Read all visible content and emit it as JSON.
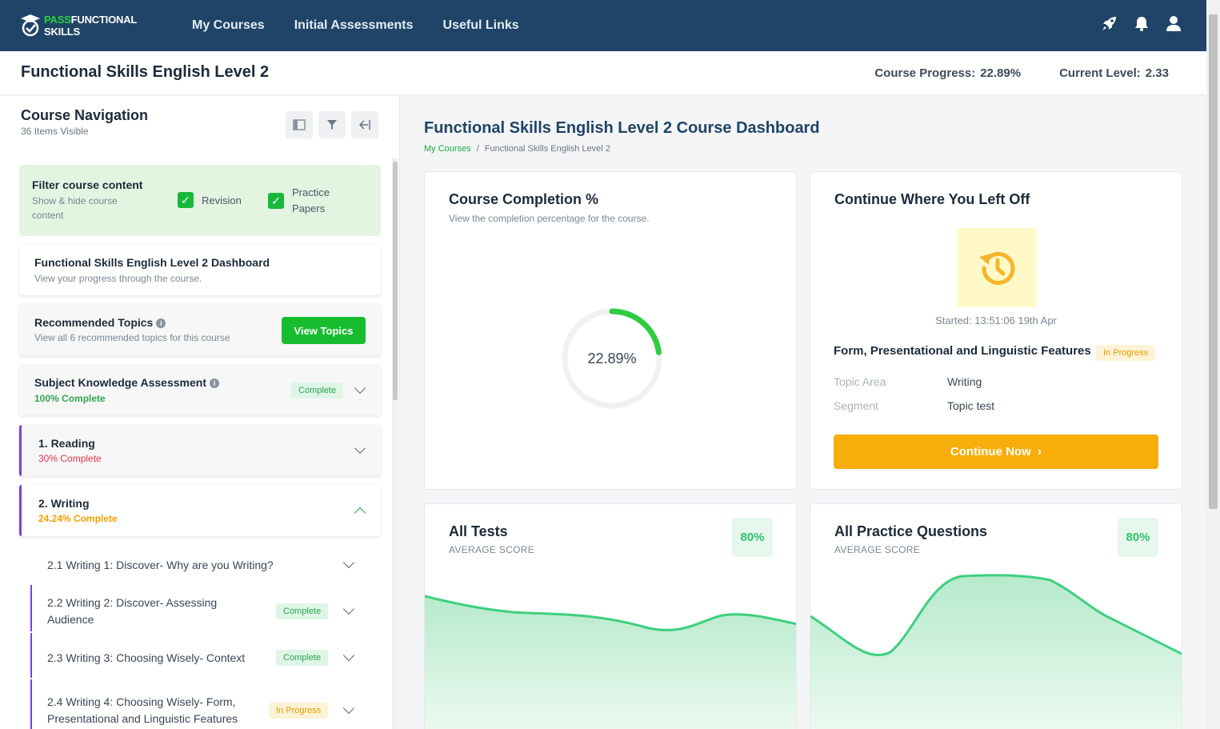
{
  "app": {
    "logo_pass": "PASS",
    "logo_rest": "FUNCTIONAL SKILLS",
    "nav": [
      "My Courses",
      "Initial Assessments",
      "Useful Links"
    ],
    "icons": [
      "rocket-icon",
      "bell-icon",
      "user-icon"
    ]
  },
  "course": {
    "title": "Functional Skills English Level 2",
    "progress_label": "Course Progress:",
    "progress_value": "22.89%",
    "level_label": "Current Level:",
    "level_value": "2.33"
  },
  "sidebar": {
    "title": "Course Navigation",
    "subtitle": "36 Items Visible",
    "filter": {
      "title": "Filter course content",
      "subtitle": "Show & hide course content",
      "options": [
        "Revision",
        "Practice Papers"
      ]
    },
    "dashboard": {
      "title": "Functional Skills English Level 2 Dashboard",
      "subtitle": "View your progress through the course."
    },
    "recommended": {
      "title": "Recommended Topics",
      "subtitle": "View all 6 recommended topics for this course",
      "button": "View Topics"
    },
    "ska": {
      "title": "Subject Knowledge Assessment",
      "percent": "100% Complete",
      "badge": "Complete"
    },
    "sections": [
      {
        "title": "1. Reading",
        "percent": "30% Complete"
      },
      {
        "title": "2. Writing",
        "percent": "24.24% Complete"
      }
    ],
    "subitems": [
      {
        "title": "2.1 Writing 1: Discover- Why are you Writing?",
        "badge": ""
      },
      {
        "title": "2.2 Writing 2: Discover- Assessing Audience",
        "badge": "Complete"
      },
      {
        "title": "2.3 Writing 3: Choosing Wisely- Context",
        "badge": "Complete"
      },
      {
        "title": "2.4 Writing 4: Choosing Wisely- Form, Presentational and Linguistic Features",
        "badge": "In Progress"
      }
    ]
  },
  "main": {
    "title": "Functional Skills English Level 2 Course Dashboard",
    "breadcrumb": [
      "My Courses",
      "Functional Skills English Level 2"
    ],
    "completion": {
      "title": "Course Completion %",
      "subtitle": "View the completion percentage for the course.",
      "value": 22.89,
      "label": "22.89%"
    },
    "continue": {
      "title": "Continue Where You Left Off",
      "started": "Started: 13:51:06 19th Apr",
      "topic": "Form, Presentational and Linguistic Features",
      "status": "In Progress",
      "topic_area_label": "Topic Area",
      "topic_area": "Writing",
      "segment_label": "Segment",
      "segment": "Topic test",
      "button": "Continue Now"
    },
    "tests": {
      "title": "All Tests",
      "subtitle": "AVERAGE SCORE",
      "score": "80%"
    },
    "practice": {
      "title": "All Practice Questions",
      "subtitle": "AVERAGE SCORE",
      "score": "80%"
    }
  },
  "colors": {
    "navbar": "#1f4467",
    "accent_green": "#18bd2f",
    "accent_purple": "#7b3fe4",
    "accent_orange": "#f7ad0a"
  }
}
